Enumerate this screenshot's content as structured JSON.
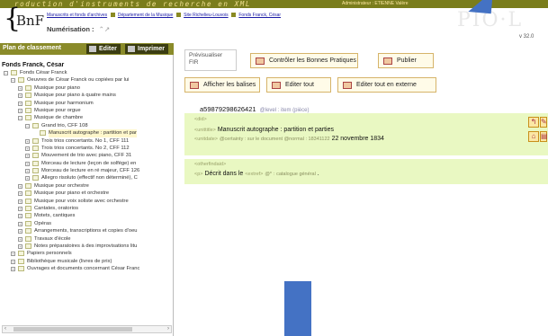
{
  "header": {
    "banner_title": "roduction d'instruments de recherche en XML",
    "banner_admin": "Administrateur : ETIENNE Valère",
    "logo_brace": "{",
    "logo_text": "BnF",
    "breadcrumbs": [
      "Manuscrits et fonds d'archives",
      "Département de la Musique",
      "Site Richelieu-Louvois",
      "Fonds Franck, César"
    ],
    "numerisation_label": "Numérisation :",
    "numerisation_icons": "⌃↗",
    "brand_right": "PIO",
    "brand_right_tail": "L",
    "version": "v 32.0"
  },
  "left_panel": {
    "title": "Plan de classement",
    "edit_label": "Editer",
    "print_label": "Imprimer",
    "tree_title": "Fonds Franck, César",
    "rows": [
      {
        "label": "Fonds César Franck",
        "level": 0,
        "toggle": "−"
      },
      {
        "label": "Oeuvres de César Franck ou copiées par lui",
        "level": 1,
        "toggle": "−"
      },
      {
        "label": "Musique pour piano",
        "level": 2,
        "toggle": "+"
      },
      {
        "label": "Musique pour piano à quatre mains",
        "level": 2,
        "toggle": "+"
      },
      {
        "label": "Musique pour harmonium",
        "level": 2,
        "toggle": "+"
      },
      {
        "label": "Musique pour orgue",
        "level": 2,
        "toggle": "+"
      },
      {
        "label": "Musique de chambre",
        "level": 2,
        "toggle": "−"
      },
      {
        "label": "Grand trio, CFF 108",
        "level": 3,
        "toggle": "−"
      },
      {
        "label": "Manuscrit autographe : partition et par",
        "level": 4,
        "toggle": "",
        "selected": true
      },
      {
        "label": "Trois trios concertants. No 1, CFF 111",
        "level": 3,
        "toggle": "+"
      },
      {
        "label": "Trois trios concertants. No 2, CFF 112",
        "level": 3,
        "toggle": "+"
      },
      {
        "label": "Mouvement de trio avec piano, CFF 31",
        "level": 3,
        "toggle": "+"
      },
      {
        "label": "Morceau de lecture (leçon de solfège) en",
        "level": 3,
        "toggle": "+"
      },
      {
        "label": "Morceau de lecture en ré majeur, CFF 126",
        "level": 3,
        "toggle": "+"
      },
      {
        "label": "Allegro risoluto (effectif non déterminé), C",
        "level": 3,
        "toggle": "+"
      },
      {
        "label": "Musique pour orchestre",
        "level": 2,
        "toggle": "+"
      },
      {
        "label": "Musique pour piano et orchestre",
        "level": 2,
        "toggle": "+"
      },
      {
        "label": "Musique pour voix soliste avec orchestre",
        "level": 2,
        "toggle": "+"
      },
      {
        "label": "Cantates, oratorios",
        "level": 2,
        "toggle": "+"
      },
      {
        "label": "Motets, cantiques",
        "level": 2,
        "toggle": "+"
      },
      {
        "label": "Opéras",
        "level": 2,
        "toggle": "+"
      },
      {
        "label": "Arrangements, transcriptions et copies d'oeu",
        "level": 2,
        "toggle": "+"
      },
      {
        "label": "Travaux d'école",
        "level": 2,
        "toggle": "+"
      },
      {
        "label": "Notes préparatoires à des improvisations litu",
        "level": 2,
        "toggle": "+"
      },
      {
        "label": "Papiers personnels",
        "level": 1,
        "toggle": "+"
      },
      {
        "label": "Bibliothèque musicale (livres de prix)",
        "level": 1,
        "toggle": "+"
      },
      {
        "label": "Ouvrages et documents concernant César Franc",
        "level": 1,
        "toggle": "+"
      }
    ]
  },
  "toolbar": {
    "preview_label": "Prévisualiser FIR",
    "check_label": "Contrôler les Bonnes Pratiques",
    "publish_label": "Publier",
    "show_tags_label": "Afficher les balises",
    "edit_all_label": "Editer tout",
    "edit_external_label": "Editer tout en externe"
  },
  "document": {
    "id": "a59879298626421",
    "id_meta": "@level : item (pièce)",
    "did_tag": "<did>",
    "unittitle_tag": "<unittitle>",
    "unittitle_value": "Manuscrit autographe : partition et parties",
    "unitdate_tag": "<unitdate>",
    "unitdate_meta": "@certainty : sur le document  @normal : 18341122",
    "unitdate_value": "22 novembre 1834",
    "otherfindaid_tag": "<otherfindaid>",
    "p_tag": "<p>",
    "p_value": "Décrit dans le",
    "extref_tag": "<extref>",
    "extref_meta": "@* :",
    "extref_value": "catalogue général",
    "trailing": "."
  },
  "colors": {
    "banner": "#7a7d1c",
    "band": "#e9f8c2",
    "button_border": "#d6b46a",
    "callout_blue": "#4472c4"
  }
}
